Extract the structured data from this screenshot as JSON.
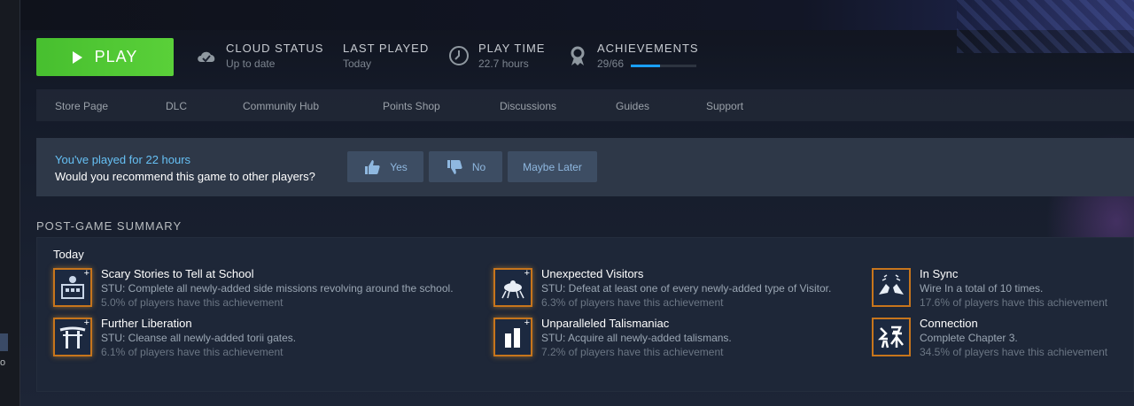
{
  "left_rail": {
    "text": "o"
  },
  "actions": {
    "play_label": "PLAY"
  },
  "stats": {
    "cloud": {
      "label": "CLOUD STATUS",
      "value": "Up to date",
      "icon": "cloud-check-icon"
    },
    "last_played": {
      "label": "LAST PLAYED",
      "value": "Today"
    },
    "play_time": {
      "label": "PLAY TIME",
      "value": "22.7 hours",
      "icon": "clock-icon"
    },
    "achievements": {
      "label": "ACHIEVEMENTS",
      "value": "29/66",
      "progress": 0.44,
      "icon": "achievement-ribbon-icon"
    }
  },
  "nav": {
    "items": [
      "Store Page",
      "DLC",
      "Community Hub",
      "Points Shop",
      "Discussions",
      "Guides",
      "Support"
    ]
  },
  "recommend": {
    "played": "You've played for 22 hours",
    "question": "Would you recommend this game to other players?",
    "yes": "Yes",
    "no": "No",
    "later": "Maybe Later"
  },
  "summary": {
    "title": "POST-GAME SUMMARY",
    "today": "Today",
    "achievements": [
      {
        "name": "Scary Stories to Tell at School",
        "desc": "STU: Complete all newly-added side missions revolving around the school.",
        "pct": "5.0% of players have this achievement",
        "icon": "school-icon"
      },
      {
        "name": "Further Liberation",
        "desc": "STU: Cleanse all newly-added torii gates.",
        "pct": "6.1% of players have this achievement",
        "icon": "torii-gate-icon"
      },
      {
        "name": "Unexpected Visitors",
        "desc": "STU: Defeat at least one of every newly-added type of Visitor.",
        "pct": "6.3% of players have this achievement",
        "icon": "visitor-icon"
      },
      {
        "name": "Unparalleled Talismaniac",
        "desc": "STU: Acquire all newly-added talismans.",
        "pct": "7.2% of players have this achievement",
        "icon": "talisman-icon"
      },
      {
        "name": "In Sync",
        "desc": "Wire In a total of 10 times.",
        "pct": "17.6% of players have this achievement",
        "icon": "hands-icon"
      },
      {
        "name": "Connection",
        "desc": "Complete Chapter 3.",
        "pct": "34.5% of players have this achievement",
        "icon": "kanji-connection-icon"
      }
    ]
  },
  "colors": {
    "play": "#5ad039",
    "accent": "#66c0f4",
    "badge_border": "#c7751c"
  }
}
